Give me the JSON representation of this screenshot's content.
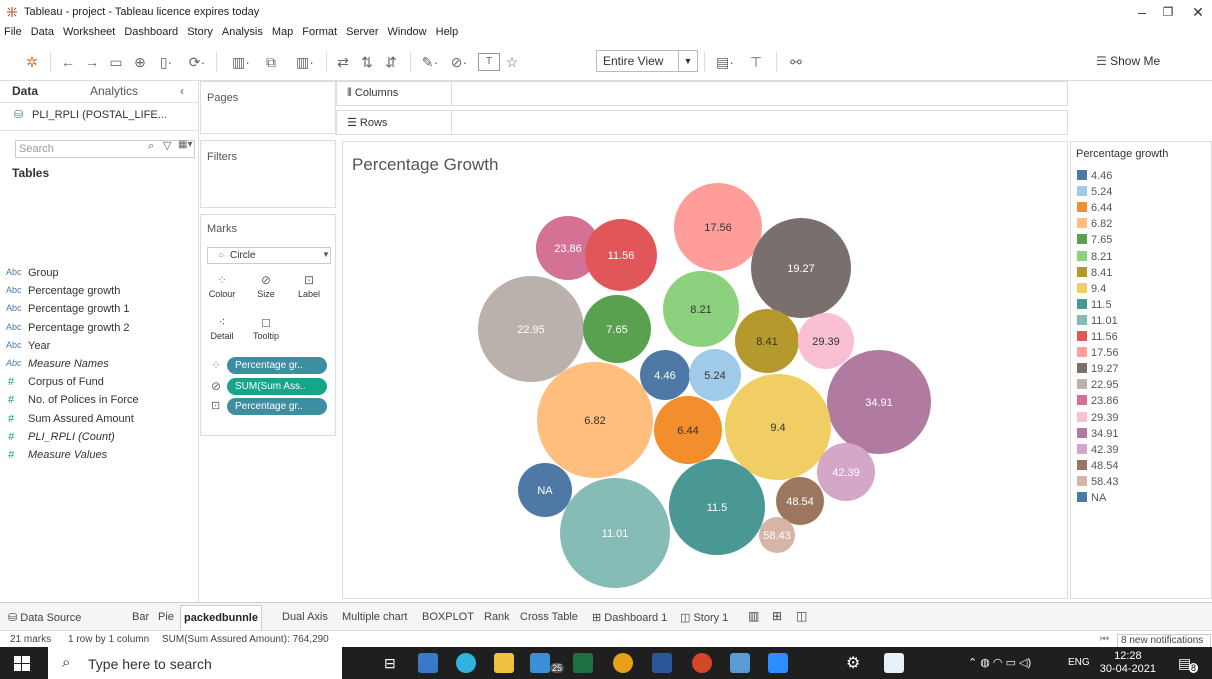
{
  "window": {
    "title": "Tableau - project - Tableau licence expires today",
    "controls": [
      "–",
      "❐",
      "✕"
    ]
  },
  "menu": [
    "File",
    "Data",
    "Worksheet",
    "Dashboard",
    "Story",
    "Analysis",
    "Map",
    "Format",
    "Server",
    "Window",
    "Help"
  ],
  "toolbar": {
    "fit_label": "Entire View",
    "show_me": "Show Me"
  },
  "data_pane": {
    "tab_data": "Data",
    "tab_analytics": "Analytics",
    "datasource": "PLI_RPLI (POSTAL_LIFE...",
    "search_placeholder": "Search",
    "tables_heading": "Tables",
    "fields": [
      {
        "type": "Abc",
        "name": "Group",
        "italic": false
      },
      {
        "type": "Abc",
        "name": "Percentage growth",
        "italic": false
      },
      {
        "type": "Abc",
        "name": "Percentage growth 1",
        "italic": false
      },
      {
        "type": "Abc",
        "name": "Percentage growth 2",
        "italic": false
      },
      {
        "type": "Abc",
        "name": "Year",
        "italic": false
      },
      {
        "type": "Abc",
        "name": "Measure Names",
        "italic": true
      },
      {
        "type": "#",
        "name": "Corpus of Fund",
        "italic": false
      },
      {
        "type": "#",
        "name": "No. of Polices in Force",
        "italic": false
      },
      {
        "type": "#",
        "name": "Sum Assured Amount",
        "italic": false
      },
      {
        "type": "#",
        "name": "PLI_RPLI (Count)",
        "italic": true
      },
      {
        "type": "#",
        "name": "Measure Values",
        "italic": true
      }
    ]
  },
  "cards": {
    "pages": "Pages",
    "filters": "Filters",
    "marks": "Marks",
    "mark_type": "Circle",
    "mark_buttons": [
      "Colour",
      "Size",
      "Label",
      "Detail",
      "Tooltip"
    ],
    "pills": [
      {
        "text": "Percentage gr..",
        "color": "#3d8ea0"
      },
      {
        "text": "SUM(Sum Ass..",
        "color": "#17a589"
      },
      {
        "text": "Percentage gr..",
        "color": "#3d8ea0"
      }
    ]
  },
  "shelves": {
    "columns": "Columns",
    "rows": "Rows"
  },
  "chart_data": {
    "type": "packed-bubble",
    "title": "Percentage Growth",
    "bubbles": [
      {
        "label": "23.86",
        "color": "#d37295"
      },
      {
        "label": "11.56",
        "color": "#e15759"
      },
      {
        "label": "17.56",
        "color": "#ff9d9a"
      },
      {
        "label": "19.27",
        "color": "#79706e"
      },
      {
        "label": "22.95",
        "color": "#bab0ac"
      },
      {
        "label": "7.65",
        "color": "#59a14f"
      },
      {
        "label": "8.21",
        "color": "#8cd17d"
      },
      {
        "label": "8.41",
        "color": "#b6992d"
      },
      {
        "label": "29.39",
        "color": "#fabfd2"
      },
      {
        "label": "4.46",
        "color": "#4e79a7"
      },
      {
        "label": "5.24",
        "color": "#a0cbe8"
      },
      {
        "label": "34.91",
        "color": "#b07aa1"
      },
      {
        "label": "6.82",
        "color": "#ffbe7d"
      },
      {
        "label": "6.44",
        "color": "#f28e2b"
      },
      {
        "label": "9.4",
        "color": "#f1ce63"
      },
      {
        "label": "42.39",
        "color": "#d4a6c8"
      },
      {
        "label": "NA",
        "color": "#4e79a7"
      },
      {
        "label": "48.54",
        "color": "#9d7660"
      },
      {
        "label": "11.5",
        "color": "#499894"
      },
      {
        "label": "11.01",
        "color": "#86bcb6"
      },
      {
        "label": "58.43",
        "color": "#d7b5a6"
      }
    ],
    "legend_title": "Percentage growth",
    "legend": [
      {
        "label": "4.46",
        "color": "#4e79a7"
      },
      {
        "label": "5.24",
        "color": "#a0cbe8"
      },
      {
        "label": "6.44",
        "color": "#f28e2b"
      },
      {
        "label": "6.82",
        "color": "#ffbe7d"
      },
      {
        "label": "7.65",
        "color": "#59a14f"
      },
      {
        "label": "8.21",
        "color": "#8cd17d"
      },
      {
        "label": "8.41",
        "color": "#b6992d"
      },
      {
        "label": "9.4",
        "color": "#f1ce63"
      },
      {
        "label": "11.5",
        "color": "#499894"
      },
      {
        "label": "11.01",
        "color": "#86bcb6"
      },
      {
        "label": "11.56",
        "color": "#e15759"
      },
      {
        "label": "17.56",
        "color": "#ff9d9a"
      },
      {
        "label": "19.27",
        "color": "#79706e"
      },
      {
        "label": "22.95",
        "color": "#bab0ac"
      },
      {
        "label": "23.86",
        "color": "#d37295"
      },
      {
        "label": "29.39",
        "color": "#fabfd2"
      },
      {
        "label": "34.91",
        "color": "#b07aa1"
      },
      {
        "label": "42.39",
        "color": "#d4a6c8"
      },
      {
        "label": "48.54",
        "color": "#9d7660"
      },
      {
        "label": "58.43",
        "color": "#d7b5a6"
      },
      {
        "label": "NA",
        "color": "#4e79a7"
      }
    ]
  },
  "sheet_tabs": [
    "Data Source",
    "Bar",
    "Pie",
    "packedbunnle",
    "Dual Axis",
    "Multiple chart",
    "BOXPLOT",
    "Rank",
    "Cross Table",
    "Dashboard 1",
    "Story 1"
  ],
  "active_sheet": "packedbunnle",
  "status": {
    "marks": "21 marks",
    "rows": "1 row by 1 column",
    "sum": "SUM(Sum Assured Amount): 764,290",
    "notifications": "8 new notifications"
  },
  "taskbar": {
    "search_placeholder": "Type here to search",
    "badge_mail": "25",
    "lang": "ENG",
    "time": "12:28",
    "date": "30-04-2021",
    "notif_count": "8"
  }
}
